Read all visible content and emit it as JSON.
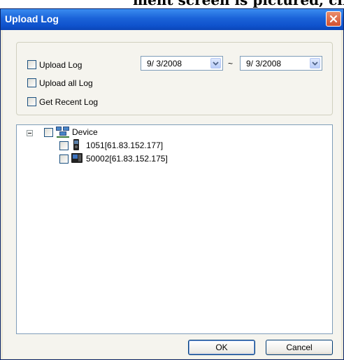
{
  "cropped_header_text": "ment screen is pictured, click the \"Upload Log\"",
  "window": {
    "title": "Upload Log"
  },
  "options": {
    "upload_log_label": "Upload Log",
    "upload_all_label": "Upload all Log",
    "recent_label": "Get Recent Log",
    "date_from": "9/ 3/2008",
    "date_separator": "~",
    "date_to": "9/ 3/2008"
  },
  "tree": {
    "root_label": "Device",
    "children": [
      {
        "label": "1051[61.83.152.177]",
        "icon": "terminal-device-icon"
      },
      {
        "label": "50002[61.83.152.175]",
        "icon": "reader-device-icon"
      }
    ]
  },
  "buttons": {
    "ok": "OK",
    "cancel": "Cancel"
  },
  "colors": {
    "titlebar": "#0f52cc",
    "close": "#d3502f",
    "dialog_bg": "#ece9d8"
  }
}
